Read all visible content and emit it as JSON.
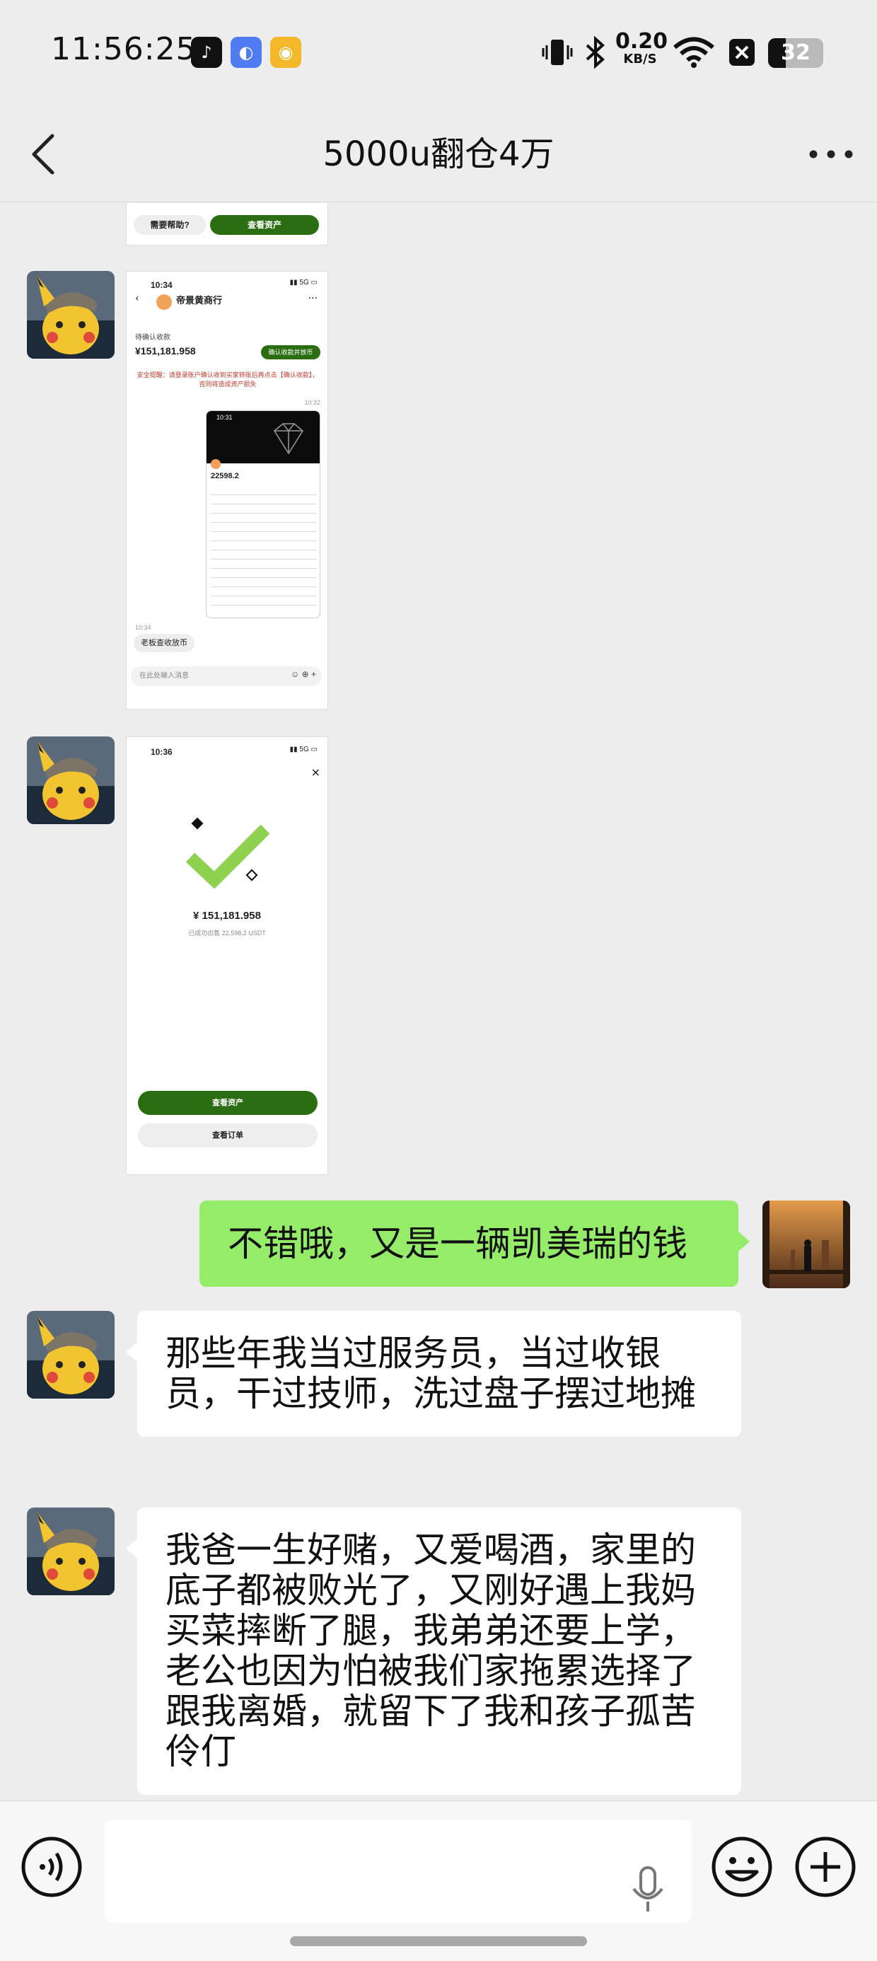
{
  "status_bar": {
    "time": "11:56:25",
    "net_speed_value": "0.20",
    "net_speed_unit": "KB/S",
    "battery_level": "32",
    "battery_fraction": 0.32,
    "app_badges": [
      "tiktok-icon",
      "browser-icon",
      "weibo-icon"
    ],
    "icons": [
      "vibrate-icon",
      "bluetooth-icon",
      "wifi-icon",
      "notification-off-icon",
      "battery-icon"
    ]
  },
  "nav": {
    "title": "5000u翻仓4万",
    "back_icon": "back-chevron-icon",
    "more_icon": "more-dots-icon"
  },
  "screenshot_1": {
    "help_button": "需要帮助?",
    "view_assets_button": "查看资产"
  },
  "screenshot_2": {
    "time": "10:34",
    "merchant_name": "帝景黄商行",
    "to_confirm_label": "待确认收款",
    "amount": "¥151,181.958",
    "confirm_button": "确认收款并放币",
    "warning": "安全提醒：请登录账户确认收到买家转账后再点击【确认收款】，否则将造成资产损失",
    "timestamp": "10:32",
    "inner_time": "10:31",
    "inner_value": "22598.2",
    "bottom_time": "10:34",
    "quick_reply": "老板查收放币",
    "input_placeholder": "在此处输入消息"
  },
  "screenshot_3": {
    "time": "10:36",
    "amount": "¥ 151,181.958",
    "sub_label": "已成功出售 22,598.2 USDT",
    "view_assets_button": "查看资产",
    "view_order_button": "查看订单"
  },
  "messages": {
    "outgoing_1": "不错哦，又是一辆凯美瑞的钱",
    "incoming_1": "那些年我当过服务员，当过收银员，干过技师，洗过盘子摆过地摊",
    "incoming_2": "我爸一生好赌，又爱喝酒，家里的底子都被败光了，又刚好遇上我妈买菜摔断了腿，我弟弟还要上学，老公也因为怕被我们家拖累选择了跟我离婚，就留下了我和孩子孤苦伶仃"
  },
  "colors": {
    "chat_bg": "#ededed",
    "outgoing_bubble": "#95ec69",
    "incoming_bubble": "#ffffff",
    "okx_green": "#2b6e12"
  }
}
